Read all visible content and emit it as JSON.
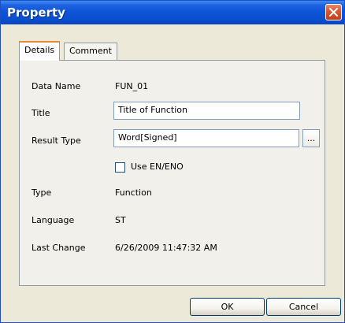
{
  "window": {
    "title": "Property"
  },
  "tabs": [
    {
      "label": "Details",
      "active": true
    },
    {
      "label": "Comment",
      "active": false
    }
  ],
  "details": {
    "data_name": {
      "label": "Data Name",
      "value": "FUN_01"
    },
    "title": {
      "label": "Title",
      "value": "Title of Function"
    },
    "result_type": {
      "label": "Result Type",
      "value": "Word[Signed]",
      "browse_label": "..."
    },
    "use_en_eno": {
      "label": "Use EN/ENO",
      "checked": false
    },
    "type": {
      "label": "Type",
      "value": "Function"
    },
    "language": {
      "label": "Language",
      "value": "ST"
    },
    "last_change": {
      "label": "Last Change",
      "value": "6/26/2009 11:47:32 AM"
    }
  },
  "buttons": {
    "ok": "OK",
    "cancel": "Cancel"
  },
  "colors": {
    "titlebar": "#0b4fd0",
    "dialog_bg": "#ece9d8",
    "close": "#d9562f",
    "active_tab_accent": "#e68b2c"
  }
}
